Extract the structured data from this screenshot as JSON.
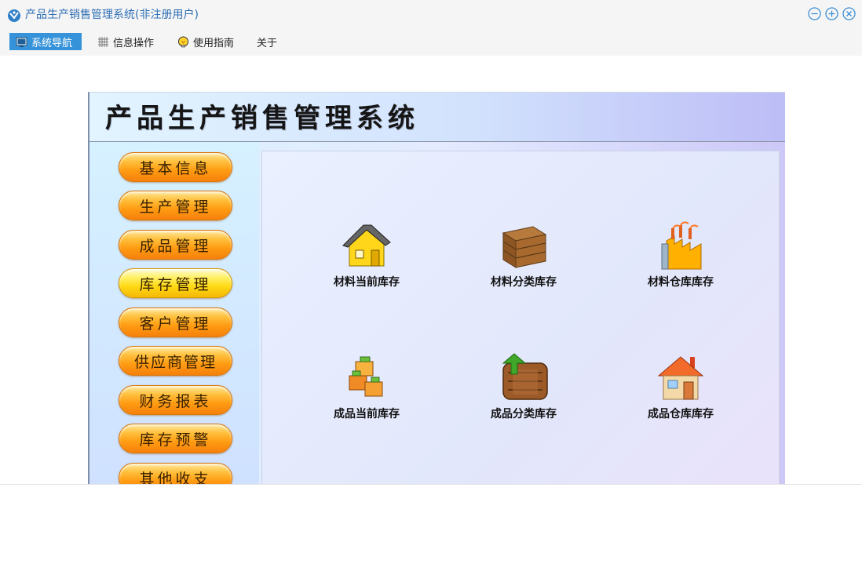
{
  "window": {
    "title": "产品生产销售管理系统(非注册用户)"
  },
  "menu": {
    "items": [
      {
        "label": "系统导航",
        "icon": "monitor-icon",
        "active": true
      },
      {
        "label": "信息操作",
        "icon": "grid-icon"
      },
      {
        "label": "使用指南",
        "icon": "lightbulb-icon"
      },
      {
        "label": "关于"
      }
    ]
  },
  "panel": {
    "title": "产品生产销售管理系统",
    "nav": [
      {
        "label": "基本信息"
      },
      {
        "label": "生产管理"
      },
      {
        "label": "成品管理"
      },
      {
        "label": "库存管理",
        "selected": true
      },
      {
        "label": "客户管理"
      },
      {
        "label": "供应商管理"
      },
      {
        "label": "财务报表"
      },
      {
        "label": "库存预警"
      },
      {
        "label": "其他收支"
      }
    ],
    "tiles": [
      {
        "label": "材料当前库存",
        "icon": "house-roof-icon"
      },
      {
        "label": "材料分类库存",
        "icon": "wooden-crate-icon"
      },
      {
        "label": "材料仓库库存",
        "icon": "factory-icon"
      },
      {
        "label": "成品当前库存",
        "icon": "stacked-boxes-icon"
      },
      {
        "label": "成品分类库存",
        "icon": "barrel-arrow-icon"
      },
      {
        "label": "成品仓库库存",
        "icon": "warehouse-house-icon"
      }
    ]
  },
  "colors": {
    "accent": "#3793d9",
    "title": "#2f6fb5",
    "nav_button": "#ff9b12"
  }
}
